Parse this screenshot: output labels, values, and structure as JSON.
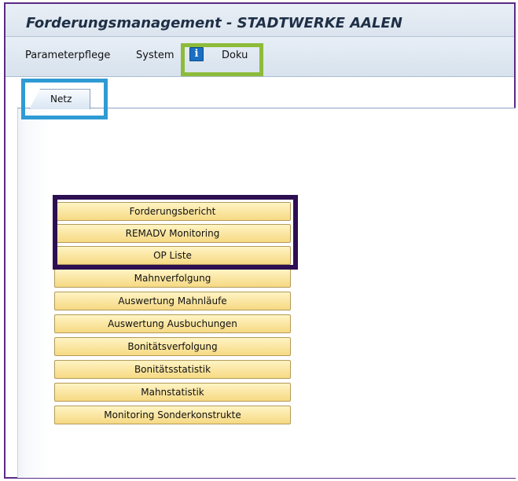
{
  "window": {
    "title": "Forderungsmanagement - STADTWERKE AALEN"
  },
  "menu": {
    "items": [
      "Parameterpflege",
      "System",
      "Doku"
    ],
    "info_icon": "info-icon"
  },
  "tabs": [
    {
      "label": "Netz",
      "selected": true
    }
  ],
  "buttons": [
    "Forderungsbericht",
    "REMADV Monitoring",
    "OP Liste",
    "Mahnverfolgung",
    "Auswertung Mahnläufe",
    "Auswertung Ausbuchungen",
    "Bonitätsverfolgung",
    "Bonitätsstatistik",
    "Mahnstatistik",
    "Monitoring Sonderkonstrukte"
  ],
  "colors": {
    "highlight_green": "#8dbb3a",
    "highlight_blue": "#2f9bd4",
    "highlight_purple": "#2d0f52",
    "frame": "#5b2a86",
    "button_fill": "#f6d983"
  }
}
